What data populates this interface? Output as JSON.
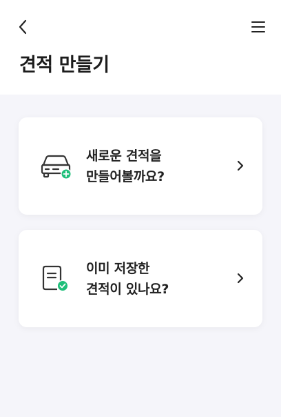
{
  "header": {
    "back_icon": "chevron-left-icon",
    "menu_icon": "hamburger-menu-icon",
    "title": "견적 만들기"
  },
  "cards": [
    {
      "icon": "car-add-icon",
      "line1": "새로운 견적을",
      "line2": "만들어볼까요?",
      "chevron_icon": "chevron-right-icon",
      "badge_color": "#1fbf7a"
    },
    {
      "icon": "document-check-icon",
      "line1": "이미 저장한",
      "line2": "견적이 있나요?",
      "chevron_icon": "chevron-right-icon",
      "badge_color": "#1fbf7a"
    }
  ]
}
